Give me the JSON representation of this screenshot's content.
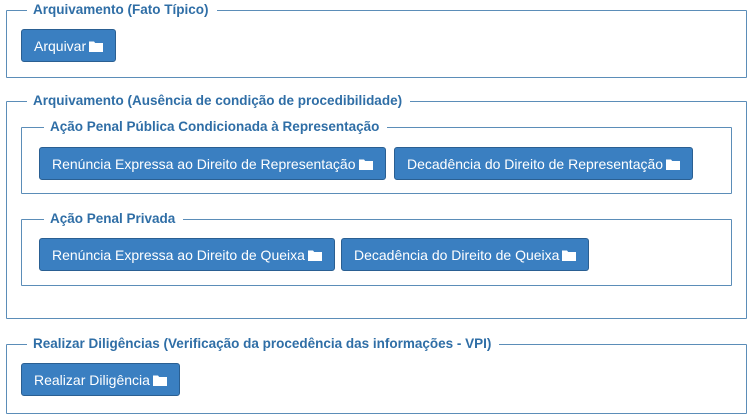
{
  "sections": [
    {
      "title": "Arquivamento (Fato Típico)",
      "buttons": [
        {
          "label": "Arquivar",
          "icon": "folder-icon"
        }
      ]
    },
    {
      "title": "Arquivamento (Ausência de condição de procedibilidade)",
      "subsections": [
        {
          "title": "Ação Penal Pública Condicionada à Representação",
          "buttons": [
            {
              "label": "Renúncia Expressa ao Direito de Representação",
              "icon": "folder-icon"
            },
            {
              "label": "Decadência do Direito de Representação",
              "icon": "folder-icon"
            }
          ]
        },
        {
          "title": "Ação Penal Privada",
          "buttons": [
            {
              "label": "Renúncia Expressa ao Direito de Queixa",
              "icon": "folder-icon"
            },
            {
              "label": "Decadência do Direito de Queixa",
              "icon": "folder-icon"
            }
          ]
        }
      ]
    },
    {
      "title": "Realizar Diligências (Verificação da procedência das informações - VPI)",
      "buttons": [
        {
          "label": "Realizar Diligência",
          "icon": "folder-icon"
        }
      ]
    }
  ],
  "colors": {
    "button_bg": "#3a7fc1",
    "border": "#5b8db8",
    "legend_text": "#2f6ea6"
  }
}
